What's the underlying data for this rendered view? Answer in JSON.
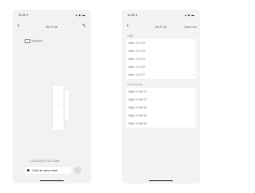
{
  "left_screen": {
    "status_time": "11:03 ✈",
    "status_icons": "▴ ◉ ▬",
    "back_icon": "chevron-left-icon",
    "title": "Wi-Fi ctr",
    "edit_icon": "pencil-icon",
    "battery_text": "Medium",
    "history_text": "2018.8.8 07:00 Close",
    "open_button_label": "Click to view more",
    "settings_icon": "gear-icon"
  },
  "right_screen": {
    "status_time": "11:03 ✈",
    "status_icons": "▴ ◉ ▬",
    "title": "Wi-Fi ctr",
    "right_text": "clean rec",
    "sections": [
      {
        "label": "Light",
        "rows": [
          "Warn. 21:4:22",
          "Warn. 21:4:29",
          "Warn. 21:6:31",
          "Warn. 21:6:52",
          "Warn. 21:6:77"
        ]
      },
      {
        "label": "Door Sensor",
        "rows": [
          "Night. 19:56:21",
          "Night. 19:56:22",
          "Night. 19:56:40",
          "Night. 19:56:36",
          "Night. 19:56:55"
        ]
      }
    ]
  }
}
